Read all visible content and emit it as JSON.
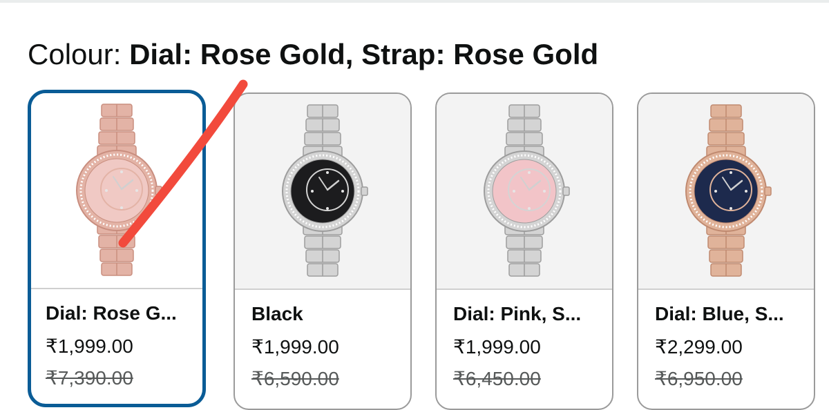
{
  "colour_selector": {
    "prefix": "Colour: ",
    "selected_value": "Dial: Rose Gold, Strap: Rose Gold"
  },
  "options": [
    {
      "label": "Dial: Rose G...",
      "price": "₹1,999.00",
      "mrp": "₹7,390.00",
      "selected": true,
      "colors": {
        "metal": "#e3b3a6",
        "metal_dark": "#c98e7f",
        "dial": "#f0c9c4",
        "background": "#ffffff"
      }
    },
    {
      "label": "Black",
      "price": "₹1,999.00",
      "mrp": "₹6,590.00",
      "selected": false,
      "colors": {
        "metal": "#d4d4d4",
        "metal_dark": "#9d9d9d",
        "dial": "#1c1c1e",
        "background": "#f3f3f3"
      }
    },
    {
      "label": "Dial: Pink, S...",
      "price": "₹1,999.00",
      "mrp": "₹6,450.00",
      "selected": false,
      "colors": {
        "metal": "#d4d4d4",
        "metal_dark": "#9d9d9d",
        "dial": "#f2c4c8",
        "background": "#f3f3f3"
      }
    },
    {
      "label": "Dial: Blue, S...",
      "price": "₹2,299.00",
      "mrp": "₹6,950.00",
      "selected": false,
      "colors": {
        "metal": "#e0b39a",
        "metal_dark": "#c08a70",
        "dial": "#1d2a4d",
        "background": "#f3f3f3"
      }
    }
  ],
  "annotation": {
    "color": "#f24a3c"
  }
}
